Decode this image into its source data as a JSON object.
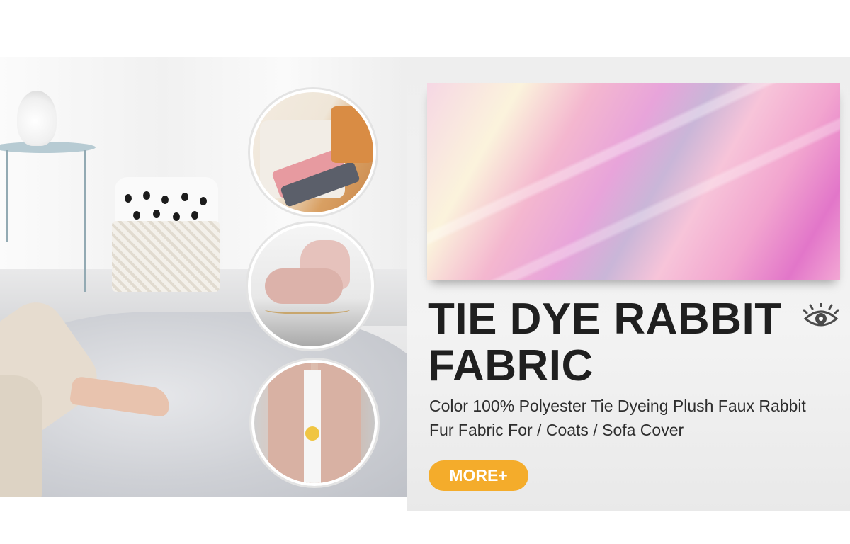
{
  "banner": {
    "title": "TIE DYE RABBIT FABRIC",
    "subtitle": "Color 100% Polyester Tie Dyeing Plush Faux Rabbit Fur Fabric For / Coats / Sofa Cover",
    "more_label": "MORE+",
    "view_icon": "eye-icon"
  },
  "colors": {
    "accent": "#f4ac2b",
    "title": "#1f1f1f",
    "panel_bg": "#eeeeee"
  }
}
